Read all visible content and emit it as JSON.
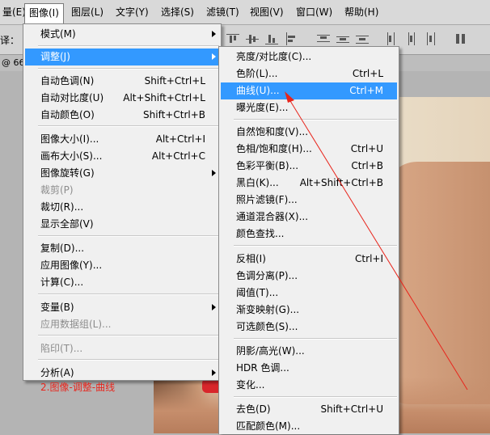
{
  "menubar": {
    "items": [
      {
        "label": "量(E)"
      },
      {
        "label": "图像(I)"
      },
      {
        "label": "图层(L)"
      },
      {
        "label": "文字(Y)"
      },
      {
        "label": "选择(S)"
      },
      {
        "label": "滤镜(T)"
      },
      {
        "label": "视图(V)"
      },
      {
        "label": "窗口(W)"
      },
      {
        "label": "帮助(H)"
      }
    ]
  },
  "toolbar": {
    "label": "译："
  },
  "docbar": {
    "label": "@ 66"
  },
  "image_menu": {
    "items": [
      {
        "label": "模式(M)",
        "shortcut": ""
      },
      {
        "label": "调整(J)",
        "shortcut": ""
      },
      {
        "label": "自动色调(N)",
        "shortcut": "Shift+Ctrl+L"
      },
      {
        "label": "自动对比度(U)",
        "shortcut": "Alt+Shift+Ctrl+L"
      },
      {
        "label": "自动颜色(O)",
        "shortcut": "Shift+Ctrl+B"
      },
      {
        "label": "图像大小(I)...",
        "shortcut": "Alt+Ctrl+I"
      },
      {
        "label": "画布大小(S)...",
        "shortcut": "Alt+Ctrl+C"
      },
      {
        "label": "图像旋转(G)",
        "shortcut": ""
      },
      {
        "label": "裁剪(P)",
        "shortcut": ""
      },
      {
        "label": "裁切(R)...",
        "shortcut": ""
      },
      {
        "label": "显示全部(V)",
        "shortcut": ""
      },
      {
        "label": "复制(D)...",
        "shortcut": ""
      },
      {
        "label": "应用图像(Y)...",
        "shortcut": ""
      },
      {
        "label": "计算(C)...",
        "shortcut": ""
      },
      {
        "label": "变量(B)",
        "shortcut": ""
      },
      {
        "label": "应用数据组(L)...",
        "shortcut": ""
      },
      {
        "label": "陷印(T)...",
        "shortcut": ""
      },
      {
        "label": "分析(A)",
        "shortcut": ""
      }
    ]
  },
  "adjust_menu": {
    "items": [
      {
        "label": "亮度/对比度(C)...",
        "shortcut": ""
      },
      {
        "label": "色阶(L)...",
        "shortcut": "Ctrl+L"
      },
      {
        "label": "曲线(U)...",
        "shortcut": "Ctrl+M"
      },
      {
        "label": "曝光度(E)...",
        "shortcut": ""
      },
      {
        "label": "自然饱和度(V)...",
        "shortcut": ""
      },
      {
        "label": "色相/饱和度(H)...",
        "shortcut": "Ctrl+U"
      },
      {
        "label": "色彩平衡(B)...",
        "shortcut": "Ctrl+B"
      },
      {
        "label": "黑白(K)...",
        "shortcut": "Alt+Shift+Ctrl+B"
      },
      {
        "label": "照片滤镜(F)...",
        "shortcut": ""
      },
      {
        "label": "通道混合器(X)...",
        "shortcut": ""
      },
      {
        "label": "颜色查找...",
        "shortcut": ""
      },
      {
        "label": "反相(I)",
        "shortcut": "Ctrl+I"
      },
      {
        "label": "色调分离(P)...",
        "shortcut": ""
      },
      {
        "label": "阈值(T)...",
        "shortcut": ""
      },
      {
        "label": "渐变映射(G)...",
        "shortcut": ""
      },
      {
        "label": "可选颜色(S)...",
        "shortcut": ""
      },
      {
        "label": "阴影/高光(W)...",
        "shortcut": ""
      },
      {
        "label": "HDR 色调...",
        "shortcut": ""
      },
      {
        "label": "变化...",
        "shortcut": ""
      },
      {
        "label": "去色(D)",
        "shortcut": "Shift+Ctrl+U"
      },
      {
        "label": "匹配颜色(M)...",
        "shortcut": ""
      }
    ]
  },
  "annotation": {
    "text": "2.图像-调整-曲线",
    "color": "#e8251c"
  },
  "colors": {
    "highlight": "#3399ff",
    "menu_bg": "#f0f0f0",
    "arrow": "#e8251c"
  }
}
